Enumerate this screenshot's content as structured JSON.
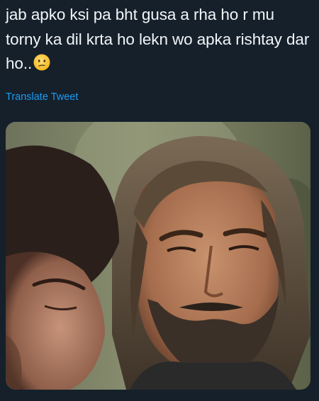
{
  "tweet": {
    "text": "jab apko ksi pa bht gusa a rha ho r mu torny ka dil krta ho lekn wo apka rishtay dar ho..",
    "emoji": "confused-face-emoji",
    "translate_label": "Translate Tweet"
  },
  "media": {
    "description_icon": "photo-image"
  },
  "colors": {
    "background": "#15202b",
    "text": "#f2f5f7",
    "link": "#1d9bf0"
  }
}
